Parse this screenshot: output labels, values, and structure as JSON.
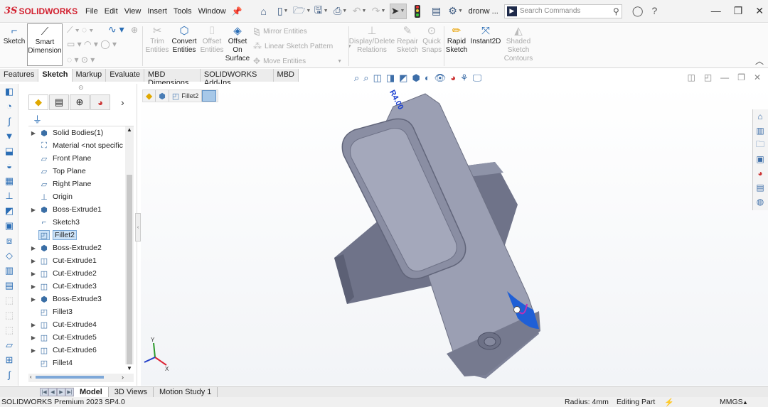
{
  "app": {
    "brand": "SOLIDWORKS",
    "document": "dronw ..."
  },
  "menu": [
    "File",
    "Edit",
    "View",
    "Insert",
    "Tools",
    "Window"
  ],
  "search": {
    "placeholder": "Search Commands"
  },
  "command_manager": {
    "sketch": "Sketch",
    "smart_dimension": [
      "Smart",
      "Dimension"
    ],
    "trim_entities": [
      "Trim",
      "Entities"
    ],
    "convert_entities": [
      "Convert",
      "Entities"
    ],
    "offset_entities": [
      "Offset",
      "Entities"
    ],
    "offset_on_surface": [
      "Offset",
      "On",
      "Surface"
    ],
    "mirror_entities": "Mirror Entities",
    "linear_sketch_pattern": "Linear Sketch Pattern",
    "move_entities": "Move Entities",
    "display_delete_relations": [
      "Display/Delete",
      "Relations"
    ],
    "repair_sketch": [
      "Repair",
      "Sketch"
    ],
    "quick_snaps": [
      "Quick",
      "Snaps"
    ],
    "rapid_sketch": [
      "Rapid",
      "Sketch"
    ],
    "instant2d": "Instant2D",
    "shaded_sketch_contours": [
      "Shaded",
      "Sketch",
      "Contours"
    ]
  },
  "tabs": [
    "Features",
    "Sketch",
    "Markup",
    "Evaluate",
    "MBD Dimensions",
    "SOLIDWORKS Add-Ins",
    "MBD"
  ],
  "active_tab": "Sketch",
  "feature_tree": [
    {
      "label": "Solid Bodies(1)",
      "icon": "solid-bodies-icon",
      "expand": true
    },
    {
      "label": "Material <not specific",
      "icon": "material-icon",
      "expand": false
    },
    {
      "label": "Front Plane",
      "icon": "plane-icon",
      "expand": false
    },
    {
      "label": "Top Plane",
      "icon": "plane-icon",
      "expand": false
    },
    {
      "label": "Right Plane",
      "icon": "plane-icon",
      "expand": false
    },
    {
      "label": "Origin",
      "icon": "origin-icon",
      "expand": false
    },
    {
      "label": "Boss-Extrude1",
      "icon": "boss-extrude-icon",
      "expand": true
    },
    {
      "label": "Sketch3",
      "icon": "sketch-icon",
      "expand": false
    },
    {
      "label": "Fillet2",
      "icon": "fillet-icon",
      "expand": false,
      "selected": true
    },
    {
      "label": "Boss-Extrude2",
      "icon": "boss-extrude-icon",
      "expand": true
    },
    {
      "label": "Cut-Extrude1",
      "icon": "cut-extrude-icon",
      "expand": true
    },
    {
      "label": "Cut-Extrude2",
      "icon": "cut-extrude-icon",
      "expand": true
    },
    {
      "label": "Cut-Extrude3",
      "icon": "cut-extrude-icon",
      "expand": true
    },
    {
      "label": "Boss-Extrude3",
      "icon": "boss-extrude-icon",
      "expand": true
    },
    {
      "label": "Fillet3",
      "icon": "fillet-icon",
      "expand": false
    },
    {
      "label": "Cut-Extrude4",
      "icon": "cut-extrude-icon",
      "expand": true
    },
    {
      "label": "Cut-Extrude5",
      "icon": "cut-extrude-icon",
      "expand": true
    },
    {
      "label": "Cut-Extrude6",
      "icon": "cut-extrude-icon",
      "expand": true
    },
    {
      "label": "Fillet4",
      "icon": "fillet-icon",
      "expand": false
    }
  ],
  "breadcrumb": {
    "item": "Fillet2"
  },
  "annotation": {
    "radius_label": "R4.00"
  },
  "bottom_tabs": [
    "Model",
    "3D Views",
    "Motion Study 1"
  ],
  "active_bottom_tab": "Model",
  "status": {
    "product": "SOLIDWORKS Premium 2023 SP4.0",
    "radius": "Radius: 4mm",
    "mode": "Editing Part",
    "units": "MMGS"
  },
  "colors": {
    "brand_red": "#d2202f",
    "part_gray": "#8e93a8",
    "highlight_blue": "#1f5fd6",
    "selection_bg": "#cde3f8"
  }
}
